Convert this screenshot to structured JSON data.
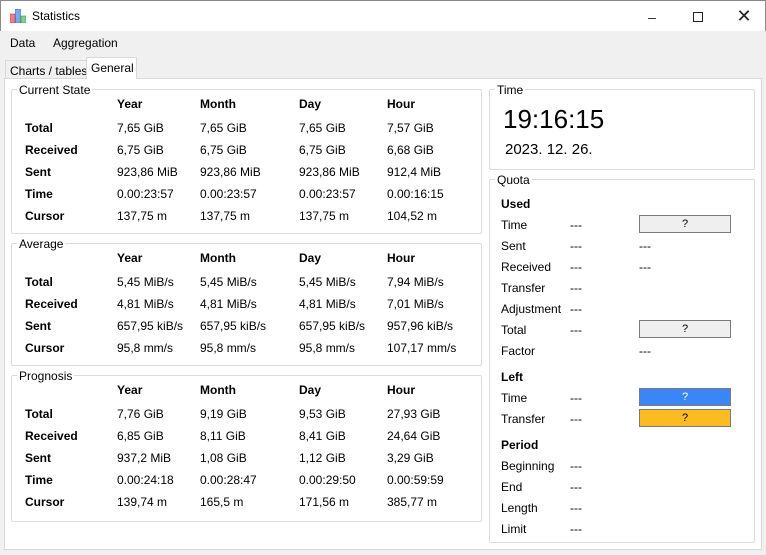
{
  "window": {
    "title": "Statistics"
  },
  "menu": [
    "Data",
    "Aggregation"
  ],
  "tabs": [
    {
      "label": "Charts / tables",
      "active": false
    },
    {
      "label": "General",
      "active": true
    }
  ],
  "columns": [
    "Year",
    "Month",
    "Day",
    "Hour"
  ],
  "groups": [
    {
      "title": "Current State",
      "rows": [
        {
          "label": "Total",
          "values": [
            "7,65 GiB",
            "7,65 GiB",
            "7,65 GiB",
            "7,57 GiB"
          ]
        },
        {
          "label": "Received",
          "values": [
            "6,75 GiB",
            "6,75 GiB",
            "6,75 GiB",
            "6,68 GiB"
          ]
        },
        {
          "label": "Sent",
          "values": [
            "923,86 MiB",
            "923,86 MiB",
            "923,86 MiB",
            "912,4 MiB"
          ]
        },
        {
          "label": "Time",
          "values": [
            "0.00:23:57",
            "0.00:23:57",
            "0.00:23:57",
            "0.00:16:15"
          ]
        },
        {
          "label": "Cursor",
          "values": [
            "137,75 m",
            "137,75 m",
            "137,75 m",
            "104,52 m"
          ]
        }
      ]
    },
    {
      "title": "Average",
      "rows": [
        {
          "label": "Total",
          "values": [
            "5,45 MiB/s",
            "5,45 MiB/s",
            "5,45 MiB/s",
            "7,94 MiB/s"
          ]
        },
        {
          "label": "Received",
          "values": [
            "4,81 MiB/s",
            "4,81 MiB/s",
            "4,81 MiB/s",
            "7,01 MiB/s"
          ]
        },
        {
          "label": "Sent",
          "values": [
            "657,95 kiB/s",
            "657,95 kiB/s",
            "657,95 kiB/s",
            "957,96 kiB/s"
          ]
        },
        {
          "label": "Cursor",
          "values": [
            "95,8 mm/s",
            "95,8 mm/s",
            "95,8 mm/s",
            "107,17 mm/s"
          ]
        }
      ]
    },
    {
      "title": "Prognosis",
      "rows": [
        {
          "label": "Total",
          "values": [
            "7,76 GiB",
            "9,19 GiB",
            "9,53 GiB",
            "27,93 GiB"
          ]
        },
        {
          "label": "Received",
          "values": [
            "6,85 GiB",
            "8,11 GiB",
            "8,41 GiB",
            "24,64 GiB"
          ]
        },
        {
          "label": "Sent",
          "values": [
            "937,2 MiB",
            "1,08 GiB",
            "1,12 GiB",
            "3,29 GiB"
          ]
        },
        {
          "label": "Time",
          "values": [
            "0.00:24:18",
            "0.00:28:47",
            "0.00:29:50",
            "0.00:59:59"
          ]
        },
        {
          "label": "Cursor",
          "values": [
            "139,74 m",
            "165,5 m",
            "171,56 m",
            "385,77 m"
          ]
        }
      ]
    }
  ],
  "time": {
    "title": "Time",
    "clock": "19:16:15",
    "date": "2023. 12. 26."
  },
  "quota": {
    "title": "Quota",
    "rows": [
      {
        "type": "head",
        "label": "Used"
      },
      {
        "label": "Time",
        "v1": "---",
        "button": "?",
        "color": "#efefef"
      },
      {
        "label": "Sent",
        "v1": "---",
        "v2": "---"
      },
      {
        "label": "Received",
        "v1": "---",
        "v2": "---"
      },
      {
        "label": "Transfer",
        "v1": "---"
      },
      {
        "label": "Adjustment",
        "v1": "---"
      },
      {
        "label": "Total",
        "v1": "---",
        "button": "?",
        "color": "#efefef"
      },
      {
        "label": "Factor",
        "v2": "---"
      },
      {
        "type": "head",
        "label": "Left"
      },
      {
        "label": "Time",
        "v1": "---",
        "button": "?",
        "color": "#3a86f6",
        "textColor": "#ffffff"
      },
      {
        "label": "Transfer",
        "v1": "---",
        "button": "?",
        "color": "#fbbb22"
      },
      {
        "type": "head",
        "label": "Period"
      },
      {
        "label": "Beginning",
        "v1": "---"
      },
      {
        "label": "End",
        "v1": "---"
      },
      {
        "label": "Length",
        "v1": "---"
      },
      {
        "label": "Limit",
        "v1": "---"
      }
    ]
  }
}
